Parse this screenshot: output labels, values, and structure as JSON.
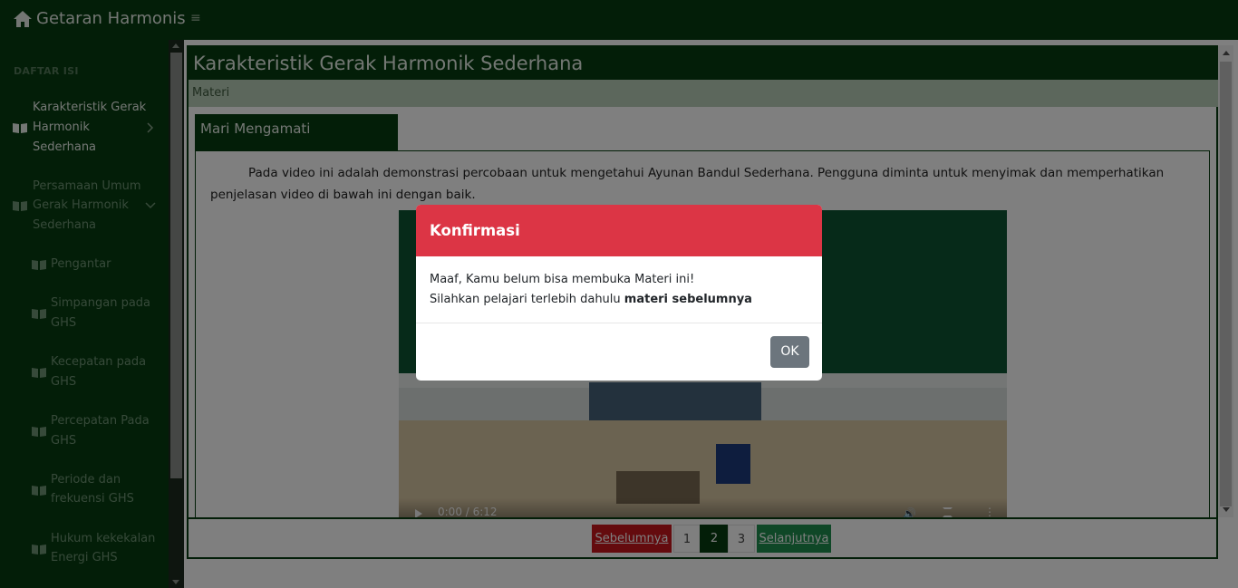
{
  "app": {
    "title": "Getaran Harmonis"
  },
  "colors": {
    "brand_green": "#063c10",
    "accent_red": "#dc3545",
    "next_green": "#1f8f4f"
  },
  "sidebar": {
    "heading": "DAFTAR ISI",
    "items": [
      {
        "lines": [
          "Karakteristik Gerak",
          "Harmonik",
          "Sederhana"
        ],
        "icon": "book-icon",
        "chevron": "chevron-right-icon",
        "state": "active"
      },
      {
        "lines": [
          "Persamaan Umum",
          "Gerak Harmonik",
          "Sederhana"
        ],
        "icon": "book-icon",
        "chevron": "chevron-down-icon",
        "state": "disabled"
      },
      {
        "lines": [
          "Pengantar"
        ],
        "icon": "book-icon",
        "state": "disabled"
      },
      {
        "lines": [
          "Simpangan pada",
          "GHS"
        ],
        "icon": "book-icon",
        "state": "disabled"
      },
      {
        "lines": [
          "Kecepatan pada",
          "GHS"
        ],
        "icon": "book-icon",
        "state": "disabled"
      },
      {
        "lines": [
          "Percepatan Pada",
          "GHS"
        ],
        "icon": "book-icon",
        "state": "disabled"
      },
      {
        "lines": [
          "Periode dan",
          "frekuensi GHS"
        ],
        "icon": "book-icon",
        "state": "disabled"
      },
      {
        "lines": [
          "Hukum kekekalan",
          "Energi GHS"
        ],
        "icon": "book-icon",
        "state": "disabled"
      }
    ]
  },
  "main": {
    "page_title": "Karakteristik Gerak Harmonik Sederhana",
    "breadcrumb": "Materi",
    "section_tab": "Mari Mengamati",
    "intro": "Pada video ini adalah demonstrasi percobaan untuk mengetahui Ayunan Bandul Sederhana. Pengguna diminta untuk menyimak dan memperhatikan penjelasan video di bawah ini dengan baik.",
    "video": {
      "time": "0:00 / 6:12",
      "progress": 0
    }
  },
  "pagination": {
    "prev": "Sebelumnya",
    "pages": [
      "1",
      "2",
      "3"
    ],
    "current": "2",
    "next": "Selanjutnya"
  },
  "modal": {
    "title": "Konfirmasi",
    "line1": "Maaf, Kamu belum bisa membuka Materi ini!",
    "line2_prefix": "Silahkan pelajari terlebih dahulu ",
    "line2_bold": "materi sebelumnya",
    "ok_label": "OK"
  }
}
